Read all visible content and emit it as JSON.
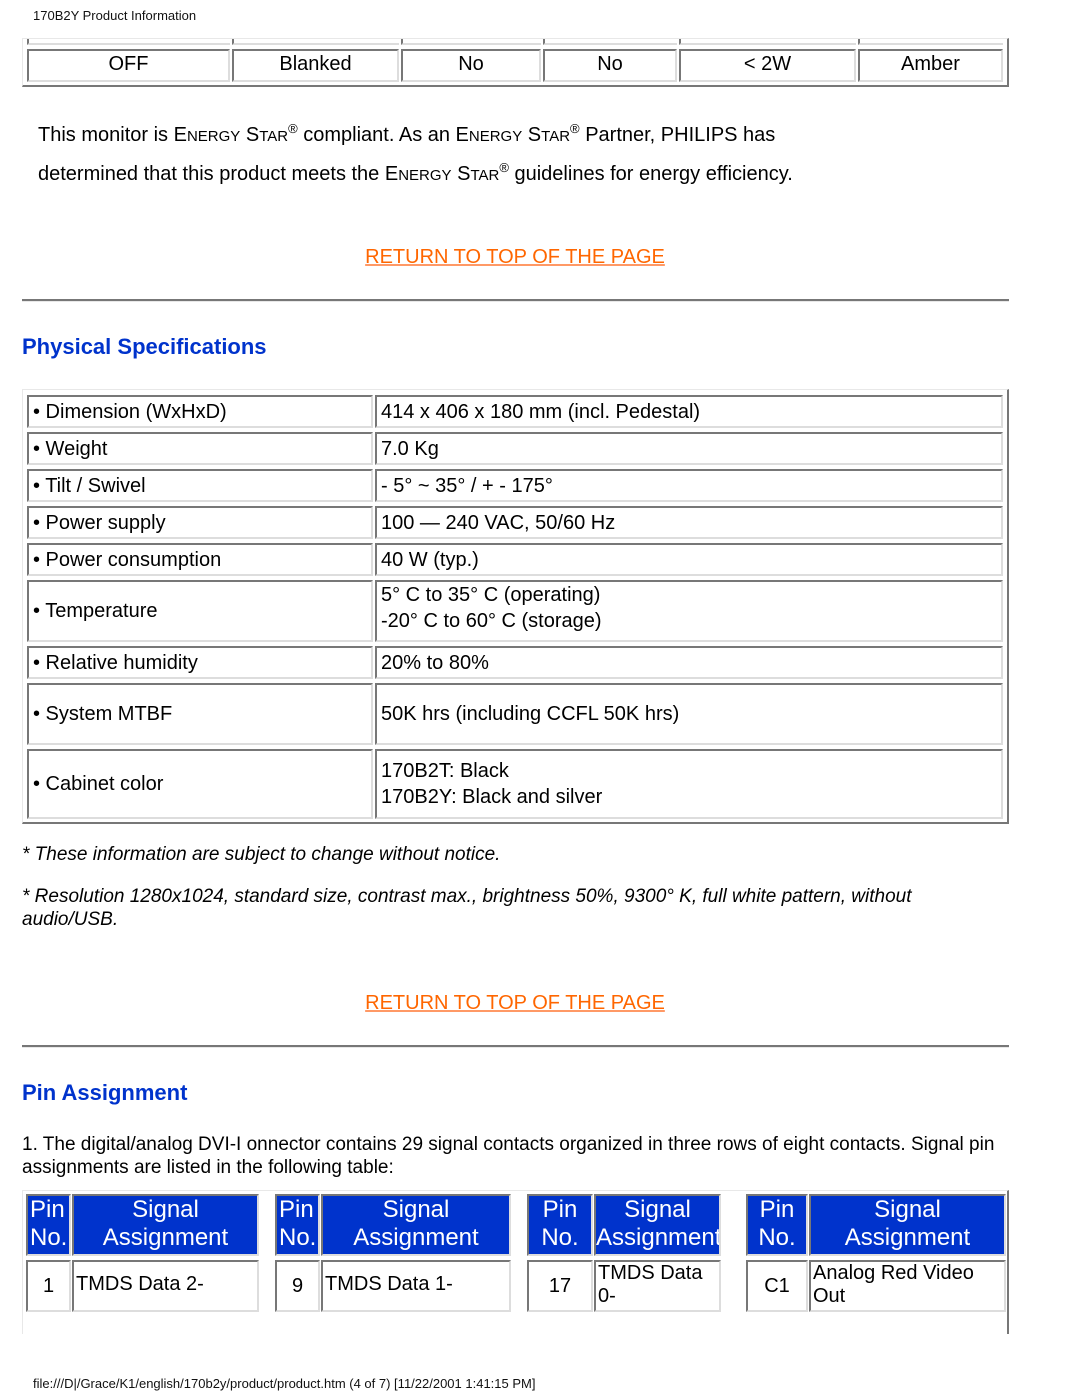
{
  "page_header": "170B2Y Product Information",
  "power_table_row": [
    "OFF",
    "Blanked",
    "No",
    "No",
    "< 2W",
    "Amber"
  ],
  "energy_star": {
    "line1_a": "This monitor is ",
    "brand_E": "E",
    "brand_NERGY": "NERGY",
    "brand_S": "S",
    "brand_TAR": "TAR",
    "reg": "®",
    "line1_b": " compliant. ",
    "as_A": "A",
    "as_rest": "s an ",
    "partner_P": "P",
    "partner_rest": "artner, ",
    "philips": "PHILIPS",
    "has": " has",
    "line2_a": "determined that this product meets the ",
    "line2_b": " guidelines for energy efficiency."
  },
  "return_link_label": "RETURN TO TOP OF THE PAGE",
  "physical": {
    "title": "Physical Specifications",
    "rows": [
      {
        "label": "• Dimension (WxHxD)",
        "value": [
          "414 x 406 x 180 mm (incl. Pedestal)"
        ]
      },
      {
        "label": "• Weight",
        "value": [
          "7.0 Kg"
        ]
      },
      {
        "label": "• Tilt / Swivel",
        "value": [
          "- 5° ~ 35° / + - 175°"
        ]
      },
      {
        "label": "• Power supply",
        "value": [
          "100 — 240 VAC, 50/60 Hz"
        ]
      },
      {
        "label": "• Power consumption",
        "value": [
          "40 W (typ.)"
        ]
      },
      {
        "label": "• Temperature",
        "value": [
          "5° C to 35° C (operating)",
          "-20° C to 60° C (storage)"
        ]
      },
      {
        "label": "• Relative humidity",
        "value": [
          "20% to 80%"
        ]
      },
      {
        "label": "• System MTBF",
        "value": [
          "50K hrs (including CCFL 50K hrs)"
        ]
      },
      {
        "label": "• Cabinet color",
        "value": [
          "170B2T: Black",
          "170B2Y: Black and silver"
        ]
      }
    ],
    "notes": [
      "* These information are subject to change without notice.",
      "* Resolution 1280x1024, standard size, contrast max., brightness 50%, 9300° K, full white pattern, without audio/USB."
    ]
  },
  "pin_assignment": {
    "title": "Pin Assignment",
    "intro": "1. The digital/analog DVI-I onnector contains 29 signal contacts organized in three rows of eight contacts. Signal pin assignments are listed in the following table:",
    "header_pin": [
      "Pin",
      "No."
    ],
    "header_signal": [
      "Signal",
      "Assignment"
    ],
    "groups": [
      {
        "pin": "1",
        "signal": [
          "TMDS Data 2-"
        ]
      },
      {
        "pin": "9",
        "signal": [
          "TMDS Data 1-"
        ]
      },
      {
        "pin": "17",
        "signal": [
          "TMDS Data",
          "0-"
        ]
      },
      {
        "pin": "C1",
        "signal": [
          "Analog Red Video",
          "Out"
        ]
      }
    ]
  },
  "footer": "file:///D|/Grace/K1/english/170b2y/product/product.htm (4 of 7) [11/22/2001 1:41:15 PM]"
}
